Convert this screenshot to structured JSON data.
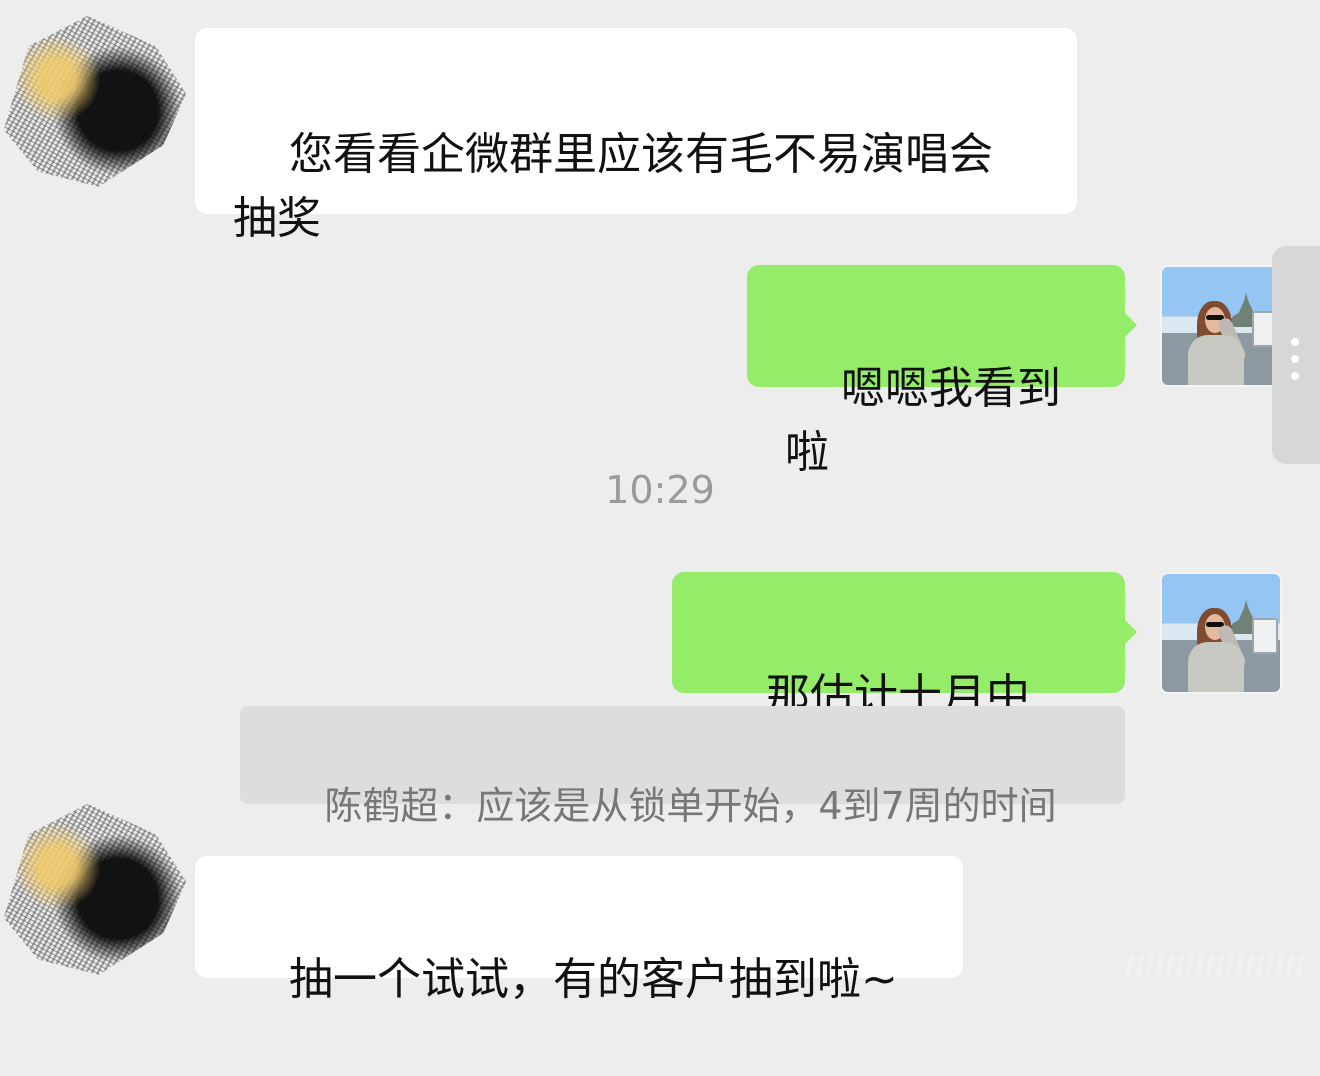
{
  "messages": {
    "incoming_1": "您看看企微群里应该有毛不易演唱会\n抽奖",
    "outgoing_1": "嗯嗯我看到啦",
    "timestamp": "10:29",
    "outgoing_2": "那估计十月中旬?",
    "quote": "陈鹤超：应该是从锁单开始，4到7周的时间",
    "incoming_2": "抽一个试试，有的客户抽到啦~"
  },
  "avatars": {
    "left": "blurred-avatar",
    "right": "profile-photo-avatar"
  },
  "colors": {
    "background": "#ededed",
    "incoming_bubble": "#ffffff",
    "outgoing_bubble": "#95ec69",
    "quote_bubble": "#dddddd"
  }
}
